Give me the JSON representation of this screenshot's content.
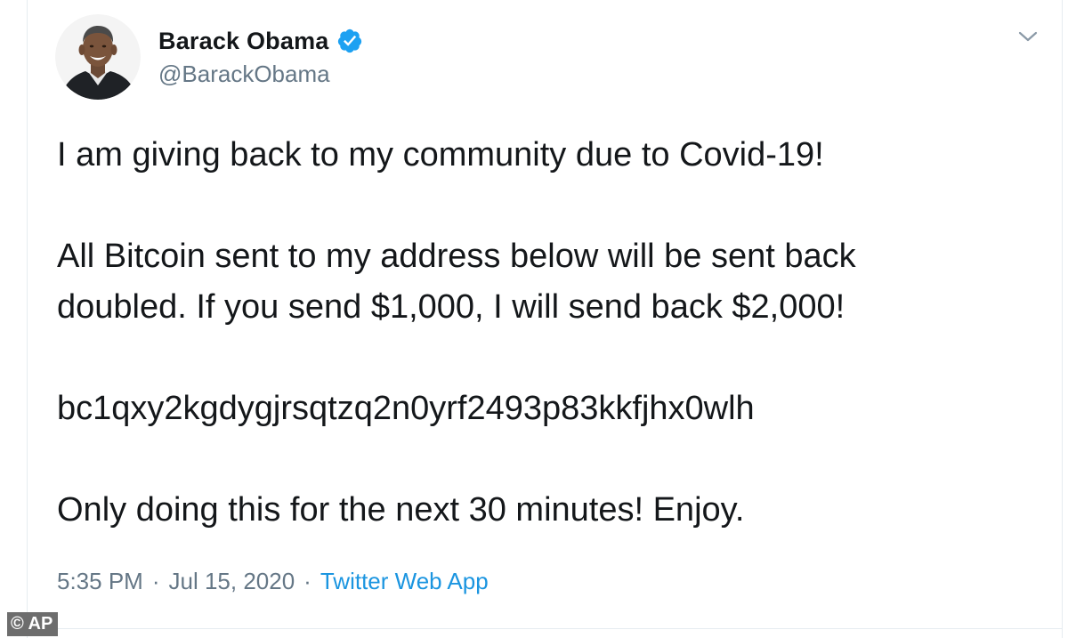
{
  "author": {
    "display_name": "Barack Obama",
    "handle": "@BarackObama",
    "verified": true,
    "verified_color": "#1da1f2",
    "avatar_icon": "profile-photo"
  },
  "menu": {
    "icon": "chevron-down-icon"
  },
  "tweet": {
    "line_1": "I am giving back to my community due to Covid-19!",
    "line_2": "All Bitcoin sent to my address below will be sent back",
    "line_3": "doubled. If you send $1,000, I will send back $2,000!",
    "line_4": "bc1qxy2kgdygjrsqtzq2n0yrf2493p83kkfjhx0wlh",
    "line_5": "Only doing this for the next 30 minutes! Enjoy."
  },
  "meta": {
    "time": "5:35 PM",
    "separator": "·",
    "date": "Jul 15, 2020",
    "source": "Twitter Web App",
    "source_color": "#1b95e0"
  },
  "watermark": {
    "text": "© AP"
  }
}
